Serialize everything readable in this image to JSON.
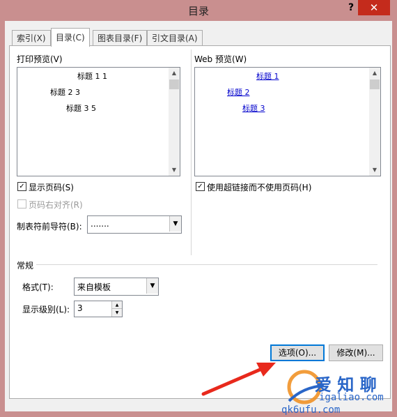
{
  "window": {
    "title": "目录",
    "help_label": "?",
    "close_label": "✕"
  },
  "tabs": [
    {
      "label": "索引(X)"
    },
    {
      "label": "目录(C)"
    },
    {
      "label": "图表目录(F)"
    },
    {
      "label": "引文目录(A)"
    }
  ],
  "print_preview": {
    "label": "打印预览(V)",
    "entries": [
      "标题 1 1",
      "标题 2 3",
      "标题 3 5"
    ]
  },
  "web_preview": {
    "label": "Web 预览(W)",
    "entries": [
      "标题 1",
      "标题 2",
      "标题 3"
    ]
  },
  "options": {
    "show_page_numbers": {
      "label": "显示页码(S)",
      "checked": true
    },
    "right_align": {
      "label": "页码右对齐(R)",
      "checked": false,
      "enabled": false
    },
    "tab_leader": {
      "label": "制表符前导符(B):",
      "value": "......."
    },
    "use_hyperlinks": {
      "label": "使用超链接而不使用页码(H)",
      "checked": true
    }
  },
  "general": {
    "section_label": "常规",
    "format": {
      "label": "格式(T):",
      "value": "来自模板"
    },
    "levels": {
      "label": "显示级别(L):",
      "value": "3"
    }
  },
  "buttons": {
    "options": "选项(O)...",
    "modify": "修改(M)..."
  },
  "watermark": {
    "text": "爱 知 聊",
    "url": "igaliao.com",
    "url2": "qk6ufu.com"
  }
}
